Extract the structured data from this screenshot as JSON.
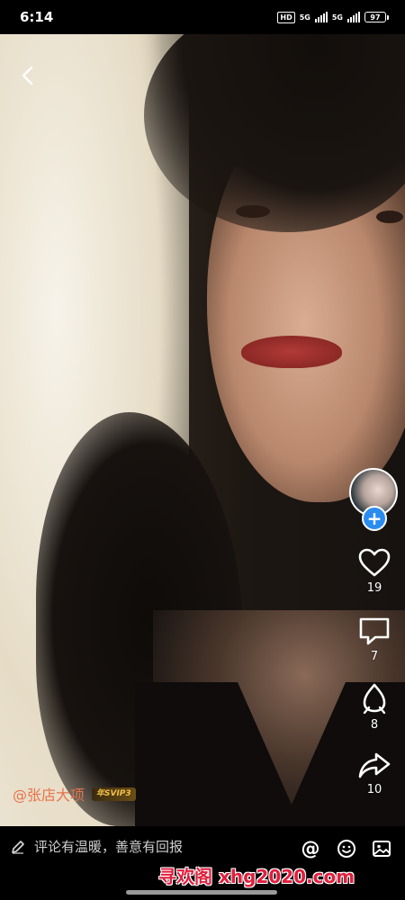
{
  "status_bar": {
    "time": "6:14",
    "hd_label": "HD",
    "network_1": "5G",
    "network_2": "5G",
    "battery": "97"
  },
  "video": {
    "back_icon": "chevron-left-icon"
  },
  "sidebar": {
    "avatar_icon": "user-avatar",
    "follow_label": "+",
    "like_count": "19",
    "comment_count": "7",
    "gift_count": "8",
    "share_count": "10"
  },
  "author": {
    "name": "@张店大项",
    "vip_badge": "年SVIP3"
  },
  "bottom_bar": {
    "comment_placeholder": "评论有温暖，善意有回报",
    "mention_label": "@",
    "watermark": "寻欢阁 xhg2020.com"
  },
  "colors": {
    "follow_blue": "#2b8cf0",
    "author_orange": "#e8734a",
    "watermark_red": "#e01f3d"
  }
}
